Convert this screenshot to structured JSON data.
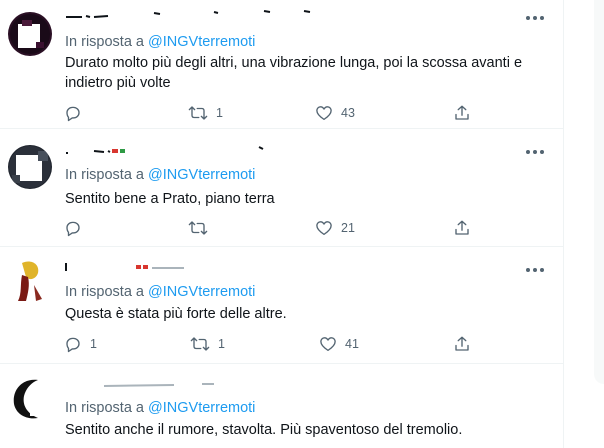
{
  "tweets": [
    {
      "reply_prefix": "In risposta a",
      "reply_handle": "@INGVterremoti",
      "text": "Durato molto più degli altri, una vibrazione lunga, poi la scossa avanti e indietro più volte",
      "reply_count": "",
      "retweet_count": "1",
      "like_count": "43"
    },
    {
      "reply_prefix": "In risposta a",
      "reply_handle": "@INGVterremoti",
      "text": "Sentito bene a Prato,  piano terra",
      "reply_count": "",
      "retweet_count": "",
      "like_count": "21"
    },
    {
      "reply_prefix": "In risposta a",
      "reply_handle": "@INGVterremoti",
      "text": "Questa è stata più forte delle altre.",
      "reply_count": "1",
      "retweet_count": "1",
      "like_count": "41"
    },
    {
      "reply_prefix": "In risposta a",
      "reply_handle": "@INGVterremoti",
      "text": "Sentito anche il rumore, stavolta. Più spaventoso del tremolio.",
      "reply_count": "",
      "retweet_count": "",
      "like_count": ""
    }
  ],
  "icons": {
    "more": "more-horizontal-icon",
    "reply": "reply-bubble-icon",
    "retweet": "retweet-arrows-icon",
    "like": "heart-icon",
    "share": "share-upload-icon"
  },
  "colors": {
    "link": "#1d9bf0",
    "secondary_text": "#536471",
    "primary_text": "#0f1419",
    "divider": "#eff3f4"
  }
}
